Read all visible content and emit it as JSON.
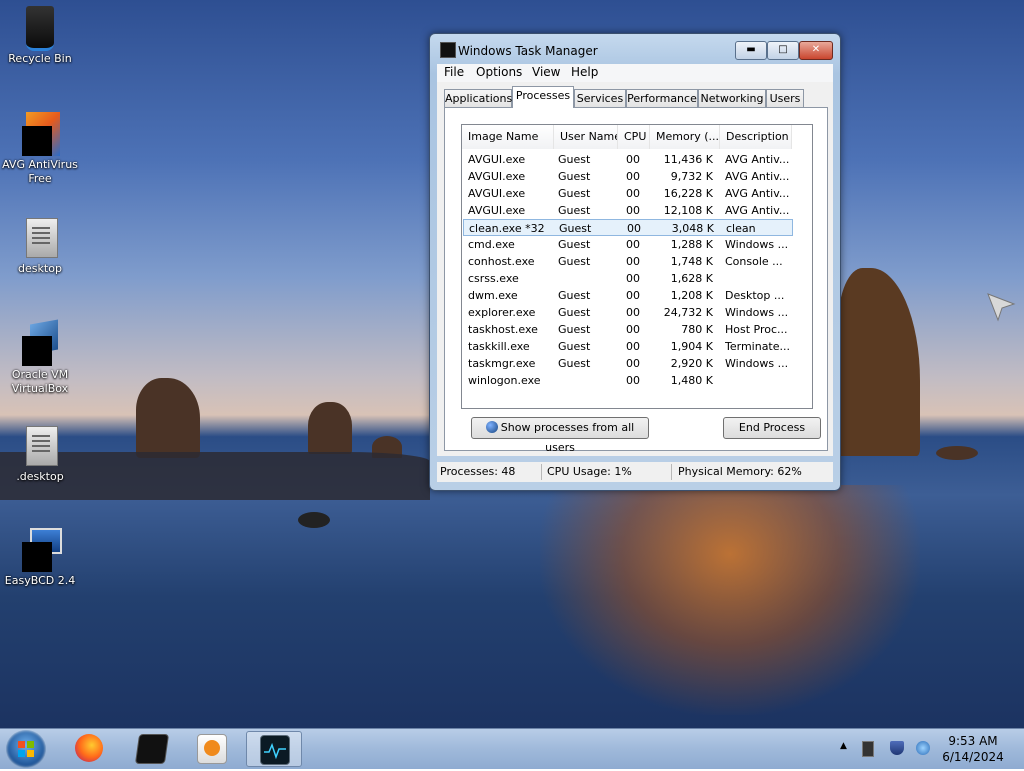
{
  "desktop": {
    "icons": [
      {
        "label": "Recycle Bin"
      },
      {
        "label": "AVG AntiVirus Free"
      },
      {
        "label": "desktop"
      },
      {
        "label": "Oracle VM VirtualBox"
      },
      {
        "label": ".desktop"
      },
      {
        "label": "EasyBCD 2.4"
      }
    ]
  },
  "window": {
    "title": "Windows Task Manager",
    "menu": [
      "File",
      "Options",
      "View",
      "Help"
    ],
    "tabs": [
      "Applications",
      "Processes",
      "Services",
      "Performance",
      "Networking",
      "Users"
    ],
    "active_tab": "Processes",
    "columns": [
      "Image Name",
      "User Name",
      "CPU",
      "Memory (...",
      "Description"
    ],
    "rows": [
      {
        "image": "AVGUI.exe",
        "user": "Guest",
        "cpu": "00",
        "mem": "11,436 K",
        "desc": "AVG Antiv..."
      },
      {
        "image": "AVGUI.exe",
        "user": "Guest",
        "cpu": "00",
        "mem": "9,732 K",
        "desc": "AVG Antiv..."
      },
      {
        "image": "AVGUI.exe",
        "user": "Guest",
        "cpu": "00",
        "mem": "16,228 K",
        "desc": "AVG Antiv..."
      },
      {
        "image": "AVGUI.exe",
        "user": "Guest",
        "cpu": "00",
        "mem": "12,108 K",
        "desc": "AVG Antiv..."
      },
      {
        "image": "clean.exe *32",
        "user": "Guest",
        "cpu": "00",
        "mem": "3,048 K",
        "desc": "clean",
        "selected": true
      },
      {
        "image": "cmd.exe",
        "user": "Guest",
        "cpu": "00",
        "mem": "1,288 K",
        "desc": "Windows ..."
      },
      {
        "image": "conhost.exe",
        "user": "Guest",
        "cpu": "00",
        "mem": "1,748 K",
        "desc": "Console ..."
      },
      {
        "image": "csrss.exe",
        "user": "",
        "cpu": "00",
        "mem": "1,628 K",
        "desc": ""
      },
      {
        "image": "dwm.exe",
        "user": "Guest",
        "cpu": "00",
        "mem": "1,208 K",
        "desc": "Desktop ..."
      },
      {
        "image": "explorer.exe",
        "user": "Guest",
        "cpu": "00",
        "mem": "24,732 K",
        "desc": "Windows ..."
      },
      {
        "image": "taskhost.exe",
        "user": "Guest",
        "cpu": "00",
        "mem": "780 K",
        "desc": "Host Proc..."
      },
      {
        "image": "taskkill.exe",
        "user": "Guest",
        "cpu": "00",
        "mem": "1,904 K",
        "desc": "Terminate..."
      },
      {
        "image": "taskmgr.exe",
        "user": "Guest",
        "cpu": "00",
        "mem": "2,920 K",
        "desc": "Windows ..."
      },
      {
        "image": "winlogon.exe",
        "user": "",
        "cpu": "00",
        "mem": "1,480 K",
        "desc": ""
      }
    ],
    "show_all_label": "Show processes from all users",
    "end_process_label": "End Process",
    "status": {
      "processes": "Processes: 48",
      "cpu": "CPU Usage: 1%",
      "memory": "Physical Memory: 62%"
    }
  },
  "taskbar": {
    "time": "9:53 AM",
    "date": "6/14/2024"
  }
}
